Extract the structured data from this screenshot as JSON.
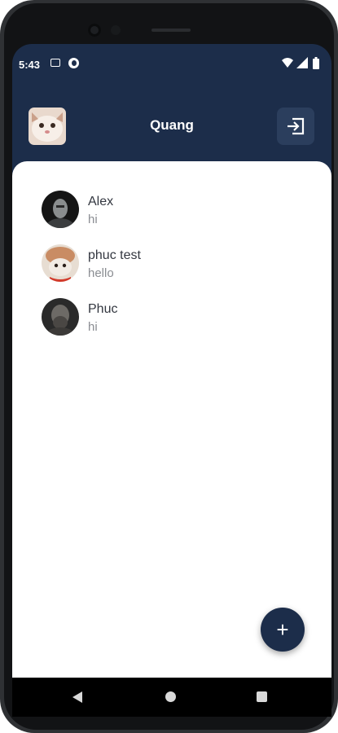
{
  "status_bar": {
    "time": "5:43",
    "icons": [
      "message-icon",
      "circle-app-icon",
      "wifi-icon",
      "signal-icon",
      "battery-icon"
    ]
  },
  "header": {
    "title": "Quang",
    "avatar": "user-avatar",
    "logout_icon": "logout-icon"
  },
  "chats": [
    {
      "name": "Alex",
      "preview": "hi",
      "avatar": "alex-avatar"
    },
    {
      "name": "phuc test",
      "preview": "hello",
      "avatar": "phuc-test-avatar"
    },
    {
      "name": "Phuc",
      "preview": "hi",
      "avatar": "phuc-avatar"
    }
  ],
  "fab": {
    "icon": "+"
  },
  "nav": [
    "back-icon",
    "home-icon",
    "recents-icon"
  ],
  "colors": {
    "primary": "#1c2d4a",
    "surface": "#ffffff",
    "name_text": "#333740",
    "preview_text": "#8a8d92"
  }
}
